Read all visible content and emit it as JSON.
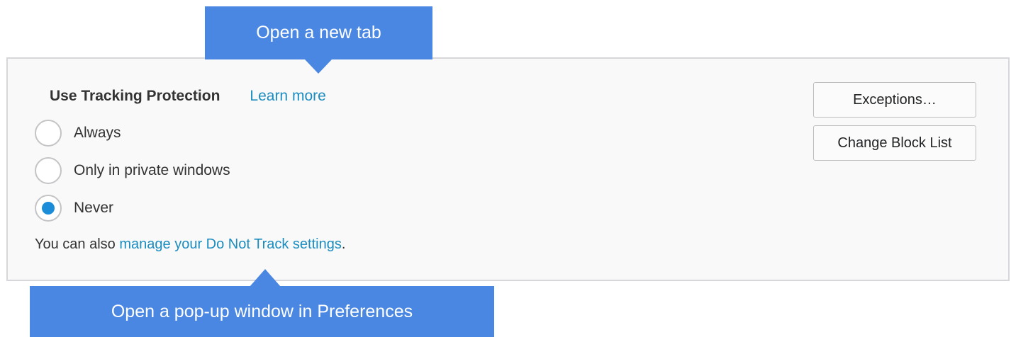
{
  "tracking": {
    "heading": "Use Tracking Protection",
    "learn_more": "Learn more",
    "options": [
      {
        "label": "Always",
        "selected": false
      },
      {
        "label": "Only in private windows",
        "selected": false
      },
      {
        "label": "Never",
        "selected": true
      }
    ],
    "dnt_prefix": "You can also ",
    "dnt_link": "manage your Do Not Track settings",
    "dnt_suffix": "."
  },
  "buttons": {
    "exceptions": "Exceptions…",
    "change_block_list": "Change Block List"
  },
  "annotations": {
    "top_callout": "Open a new tab",
    "bottom_callout": "Open a pop-up window in Preferences"
  },
  "colors": {
    "callout": "#4a87e3",
    "link": "#1a8cbf",
    "radio_selected": "#1a8cd8",
    "panel_bg": "#f9f9f9"
  }
}
